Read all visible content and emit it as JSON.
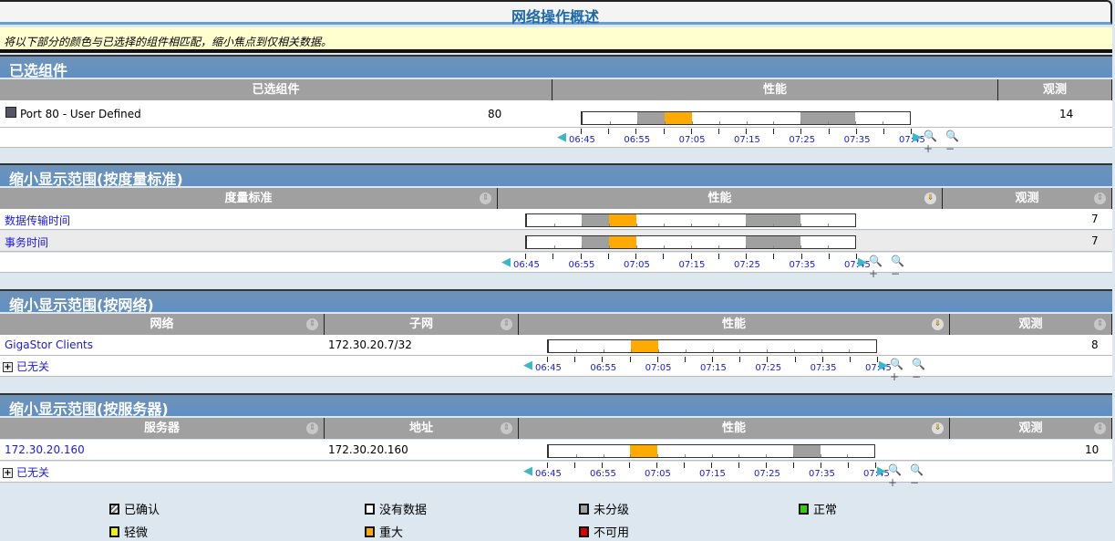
{
  "title": "网络操作概述",
  "notice": "将以下部分的颜色与已选择的组件相匹配，缩小焦点到仅相关数据。",
  "colors": {
    "confirmed": "#999",
    "nodata": "#ffffff",
    "unclassified": "#a0a0a0",
    "normal": "#33cc11",
    "minor": "#eeee11",
    "major": "#ffaa00",
    "unavailable": "#dd0000"
  },
  "axis_labels": [
    "06:45",
    "06:55",
    "07:05",
    "07:15",
    "07:25",
    "07:35",
    "07:45"
  ],
  "s1": {
    "title": "已选组件",
    "cols": [
      "已选组件",
      "性能",
      "观测"
    ],
    "row": {
      "name": "Port 80 - User Defined",
      "value": "80",
      "obs": "14",
      "timeline": [
        "nodata",
        "nodata",
        "unclassified",
        "major",
        "nodata",
        "nodata",
        "nodata",
        "nodata",
        "unclassified",
        "unclassified",
        "nodata",
        "nodata"
      ]
    }
  },
  "s2": {
    "title": "缩小显示范围(按度量标准)",
    "cols": [
      "度量标准",
      "性能",
      "观测"
    ],
    "rows": [
      {
        "name": "数据传输时间",
        "obs": "7",
        "timeline": [
          "nodata",
          "nodata",
          "unclassified",
          "major",
          "nodata",
          "nodata",
          "nodata",
          "nodata",
          "unclassified",
          "unclassified",
          "nodata",
          "nodata"
        ]
      },
      {
        "name": "事务时间",
        "obs": "7",
        "timeline": [
          "nodata",
          "nodata",
          "unclassified",
          "major",
          "nodata",
          "nodata",
          "nodata",
          "nodata",
          "unclassified",
          "unclassified",
          "nodata",
          "nodata"
        ]
      }
    ]
  },
  "s3": {
    "title": "缩小显示范围(按网络)",
    "cols": [
      "网络",
      "子网",
      "性能",
      "观测"
    ],
    "row": {
      "name": "GigaStor Clients",
      "subnet": "172.30.20.7/32",
      "obs": "8",
      "timeline": [
        "nodata",
        "nodata",
        "nodata",
        "major",
        "nodata",
        "nodata",
        "nodata",
        "nodata",
        "nodata",
        "nodata",
        "nodata",
        "nodata"
      ]
    },
    "irrelevant": "已无关"
  },
  "s4": {
    "title": "缩小显示范围(按服务器)",
    "cols": [
      "服务器",
      "地址",
      "性能",
      "观测"
    ],
    "row": {
      "name": "172.30.20.160",
      "address": "172.30.20.160",
      "obs": "10",
      "timeline": [
        "nodata",
        "nodata",
        "nodata",
        "major",
        "nodata",
        "nodata",
        "nodata",
        "nodata",
        "nodata",
        "unclassified",
        "nodata",
        "nodata"
      ]
    },
    "irrelevant": "已无关"
  },
  "legend": [
    {
      "key": "confirmed",
      "label": "已确认"
    },
    {
      "key": "nodata",
      "label": "没有数据"
    },
    {
      "key": "unclassified",
      "label": "未分级"
    },
    {
      "key": "normal",
      "label": "正常"
    },
    {
      "key": "minor",
      "label": "轻微"
    },
    {
      "key": "major",
      "label": "重大"
    },
    {
      "key": "unavailable",
      "label": "不可用"
    }
  ]
}
